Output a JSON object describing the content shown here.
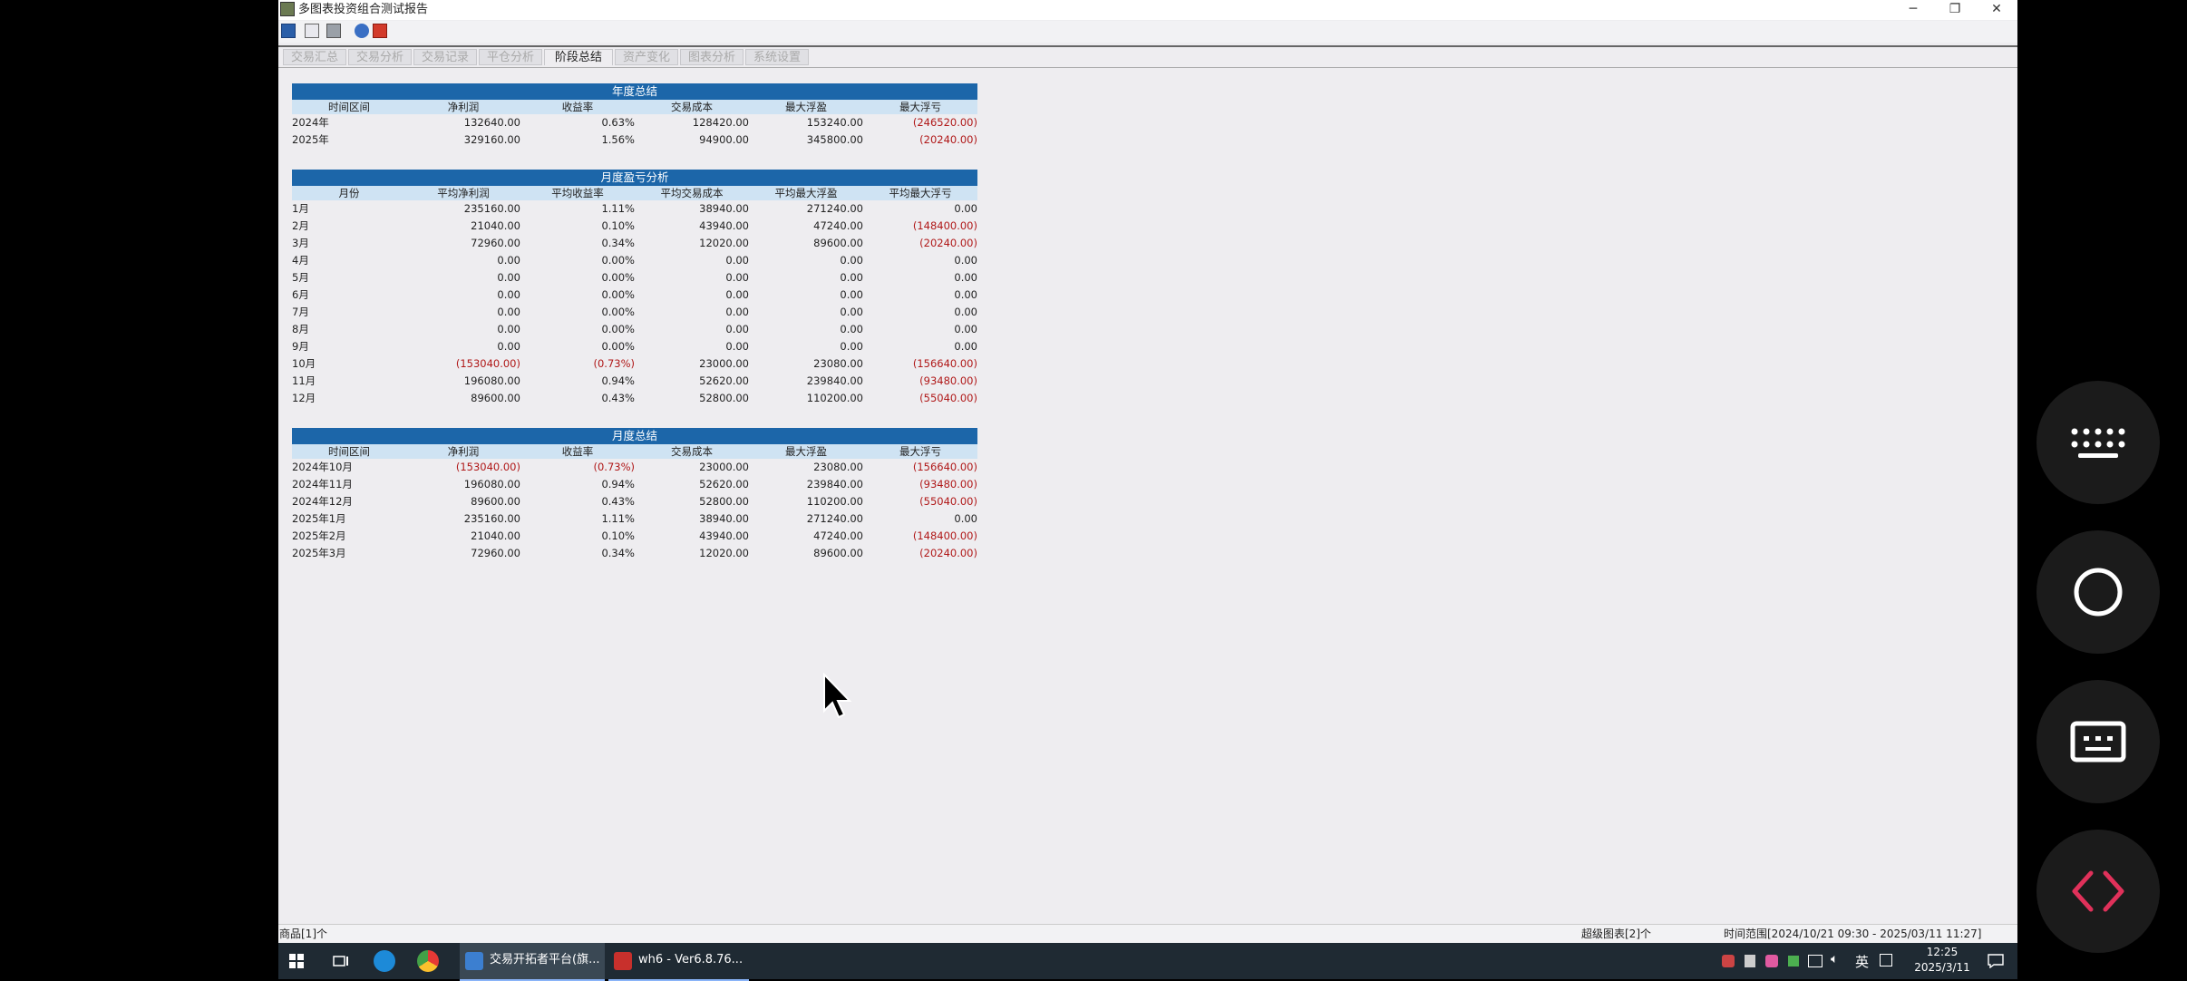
{
  "window": {
    "title": "多图表投资组合测试报告",
    "buttons": [
      "─",
      "❐",
      "✕"
    ]
  },
  "toolbar": {
    "icons": [
      "save-icon",
      "copy-icon",
      "print-icon",
      "help-icon",
      "close-icon"
    ]
  },
  "tabs": [
    {
      "label": "交易汇总",
      "active": false
    },
    {
      "label": "交易分析",
      "active": false
    },
    {
      "label": "交易记录",
      "active": false
    },
    {
      "label": "平仓分析",
      "active": false
    },
    {
      "label": "阶段总结",
      "active": true
    },
    {
      "label": "资产变化",
      "active": false
    },
    {
      "label": "图表分析",
      "active": false
    },
    {
      "label": "系统设置",
      "active": false
    }
  ],
  "yearly": {
    "title": "年度总结",
    "headers": [
      "时间区间",
      "净利润",
      "收益率",
      "交易成本",
      "最大浮盈",
      "最大浮亏"
    ],
    "rows": [
      [
        "2024年",
        "132640.00",
        "0.63%",
        "128420.00",
        "153240.00",
        "(246520.00)"
      ],
      [
        "2025年",
        "329160.00",
        "1.56%",
        "94900.00",
        "345800.00",
        "(20240.00)"
      ]
    ]
  },
  "monthly_pl": {
    "title": "月度盈亏分析",
    "headers": [
      "月份",
      "平均净利润",
      "平均收益率",
      "平均交易成本",
      "平均最大浮盈",
      "平均最大浮亏"
    ],
    "rows": [
      [
        "1月",
        "235160.00",
        "1.11%",
        "38940.00",
        "271240.00",
        "0.00"
      ],
      [
        "2月",
        "21040.00",
        "0.10%",
        "43940.00",
        "47240.00",
        "(148400.00)"
      ],
      [
        "3月",
        "72960.00",
        "0.34%",
        "12020.00",
        "89600.00",
        "(20240.00)"
      ],
      [
        "4月",
        "0.00",
        "0.00%",
        "0.00",
        "0.00",
        "0.00"
      ],
      [
        "5月",
        "0.00",
        "0.00%",
        "0.00",
        "0.00",
        "0.00"
      ],
      [
        "6月",
        "0.00",
        "0.00%",
        "0.00",
        "0.00",
        "0.00"
      ],
      [
        "7月",
        "0.00",
        "0.00%",
        "0.00",
        "0.00",
        "0.00"
      ],
      [
        "8月",
        "0.00",
        "0.00%",
        "0.00",
        "0.00",
        "0.00"
      ],
      [
        "9月",
        "0.00",
        "0.00%",
        "0.00",
        "0.00",
        "0.00"
      ],
      [
        "10月",
        "(153040.00)",
        "(0.73%)",
        "23000.00",
        "23080.00",
        "(156640.00)"
      ],
      [
        "11月",
        "196080.00",
        "0.94%",
        "52620.00",
        "239840.00",
        "(93480.00)"
      ],
      [
        "12月",
        "89600.00",
        "0.43%",
        "52800.00",
        "110200.00",
        "(55040.00)"
      ]
    ]
  },
  "monthly_summary": {
    "title": "月度总结",
    "headers": [
      "时间区间",
      "净利润",
      "收益率",
      "交易成本",
      "最大浮盈",
      "最大浮亏"
    ],
    "rows": [
      [
        "2024年10月",
        "(153040.00)",
        "(0.73%)",
        "23000.00",
        "23080.00",
        "(156640.00)"
      ],
      [
        "2024年11月",
        "196080.00",
        "0.94%",
        "52620.00",
        "239840.00",
        "(93480.00)"
      ],
      [
        "2024年12月",
        "89600.00",
        "0.43%",
        "52800.00",
        "110200.00",
        "(55040.00)"
      ],
      [
        "2025年1月",
        "235160.00",
        "1.11%",
        "38940.00",
        "271240.00",
        "0.00"
      ],
      [
        "2025年2月",
        "21040.00",
        "0.10%",
        "43940.00",
        "47240.00",
        "(148400.00)"
      ],
      [
        "2025年3月",
        "72960.00",
        "0.34%",
        "12020.00",
        "89600.00",
        "(20240.00)"
      ]
    ]
  },
  "statusbar": {
    "left": "商品[1]个",
    "middle": "超级图表[2]个",
    "right": "时间范围[2024/10/21 09:30 - 2025/03/11 11:27]"
  },
  "taskbar": {
    "items": [
      "交易开拓者平台(旗...",
      "wh6  -  Ver6.8.76..."
    ],
    "ime": "英",
    "time": "12:25",
    "date": "2025/3/11"
  },
  "colors": {
    "header_blue": "#1c66a9",
    "subheader": "#cfe3f3",
    "negative": "#b01818",
    "side_accent": "#e0315a"
  }
}
